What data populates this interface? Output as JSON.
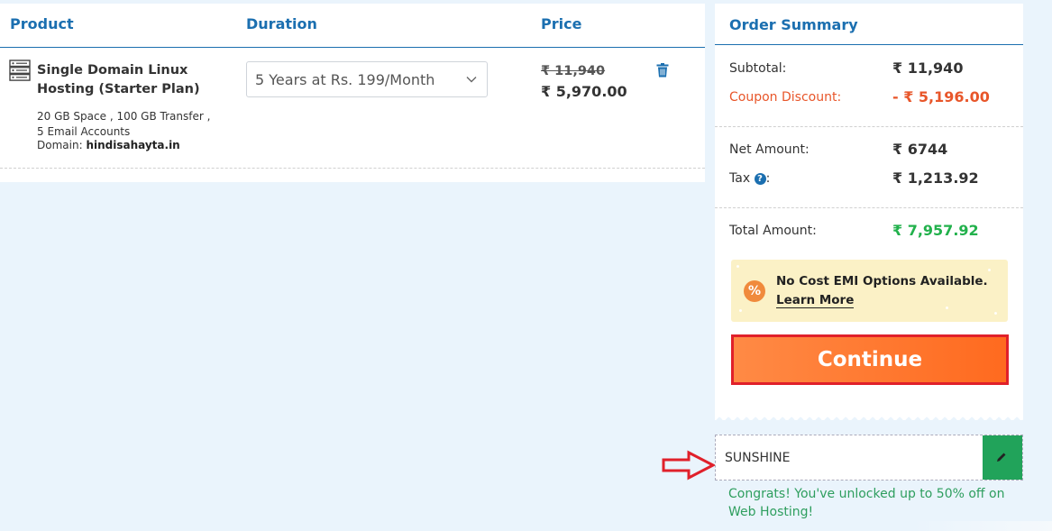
{
  "cart": {
    "headers": {
      "product": "Product",
      "duration": "Duration",
      "price": "Price"
    },
    "item": {
      "name": "Single Domain Linux Hosting (Starter Plan)",
      "specs_line1": "20 GB Space , 100 GB Transfer ,",
      "specs_line2": "5 Email Accounts",
      "domain_label": "Domain:",
      "domain_value": "hindisahayta.in",
      "duration_selected": "5 Years at Rs. 199/Month",
      "price_original": "₹ 11,940",
      "price_current": "₹ 5,970.00"
    }
  },
  "summary": {
    "title": "Order Summary",
    "subtotal_label": "Subtotal:",
    "subtotal_value": "₹ 11,940",
    "coupon_label": "Coupon Discount:",
    "coupon_value": "- ₹ 5,196.00",
    "net_label": "Net Amount:",
    "net_value": "₹ 6744",
    "tax_label": "Tax",
    "tax_suffix": ":",
    "tax_value": "₹ 1,213.92",
    "total_label": "Total Amount:",
    "total_value": "₹ 7,957.92",
    "emi_text": "No Cost EMI Options Available.",
    "emi_link": "Learn More",
    "continue_label": "Continue"
  },
  "coupon": {
    "code": "SUNSHINE",
    "message": "Congrats! You've unlocked up to 50% off on Web Hosting!"
  },
  "icons": {
    "product": "server-icon",
    "delete": "trash-icon",
    "dropdown": "chevron-down-icon",
    "tax_info": "question-icon",
    "emi": "percent-icon",
    "edit": "pencil-icon",
    "annotation": "arrow-right-icon"
  },
  "colors": {
    "brand_blue": "#1b6fb0",
    "discount_red": "#e8562a",
    "total_green": "#22b14c",
    "continue_orange": "#ff7a30",
    "annotation_red": "#e0202a",
    "edit_green": "#21a35a"
  }
}
